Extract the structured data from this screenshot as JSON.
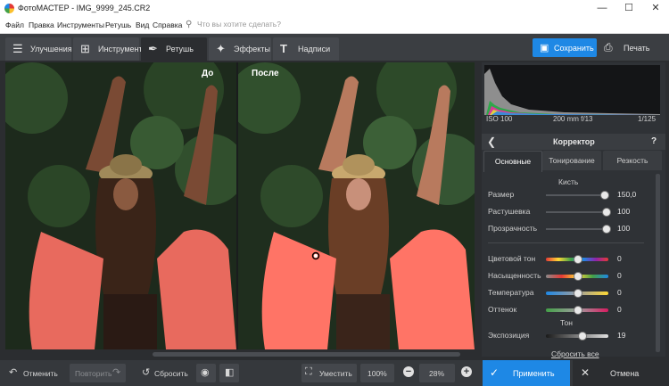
{
  "window": {
    "title": "ФотоМАСТЕР - IMG_9999_245.CR2"
  },
  "menu": {
    "items": [
      "Файл",
      "Правка",
      "Инструменты",
      "Ретушь",
      "Вид",
      "Справка"
    ],
    "search_placeholder": "Что вы хотите сделать?"
  },
  "tabs": [
    {
      "label": "Улучшения",
      "icon": "sliders-icon"
    },
    {
      "label": "Инструменты",
      "icon": "crop-icon"
    },
    {
      "label": "Ретушь",
      "icon": "brush-icon"
    },
    {
      "label": "Эффекты",
      "icon": "magic-wand-icon"
    },
    {
      "label": "Надписи",
      "icon": "text-icon"
    }
  ],
  "active_tab": "Ретушь",
  "actions": {
    "save_label": "Сохранить",
    "print_label": "Печать"
  },
  "preview": {
    "before_label": "До",
    "after_label": "После"
  },
  "exif": {
    "iso": "ISO 100",
    "lens": "200 mm f/13",
    "shutter": "1/125"
  },
  "panel": {
    "title": "Корректор",
    "back_icon": "chevron-left-icon",
    "help": "?",
    "subtabs": [
      "Основные",
      "Тонирование",
      "Резкость"
    ],
    "active_subtab": "Основные",
    "brush_section": "Кисть",
    "brush": [
      {
        "name": "Размер",
        "value": "150,0",
        "level": 0.95
      },
      {
        "name": "Растушевка",
        "value": "100",
        "level": 1.0
      },
      {
        "name": "Прозрачность",
        "value": "100",
        "level": 1.0
      }
    ],
    "color": [
      {
        "name": "Цветовой тон",
        "value": "0",
        "level": 0.5
      },
      {
        "name": "Насыщенность",
        "value": "0",
        "level": 0.5
      },
      {
        "name": "Температура",
        "value": "0",
        "level": 0.5
      },
      {
        "name": "Оттенок",
        "value": "0",
        "level": 0.5
      }
    ],
    "tone_section": "Тон",
    "tone": [
      {
        "name": "Экспозиция",
        "value": "19",
        "level": 0.58
      }
    ],
    "reset_all": "Сбросить все"
  },
  "bottom": {
    "undo": "Отменить",
    "redo": "Повторить",
    "reset": "Сбросить",
    "fit": "Уместить",
    "zoom100": "100%",
    "zoom": "28%",
    "apply": "Применить",
    "cancel": "Отмена"
  },
  "colors": {
    "accent": "#1e88e5",
    "bg": "#2b2d30",
    "panel": "#2f3236"
  }
}
